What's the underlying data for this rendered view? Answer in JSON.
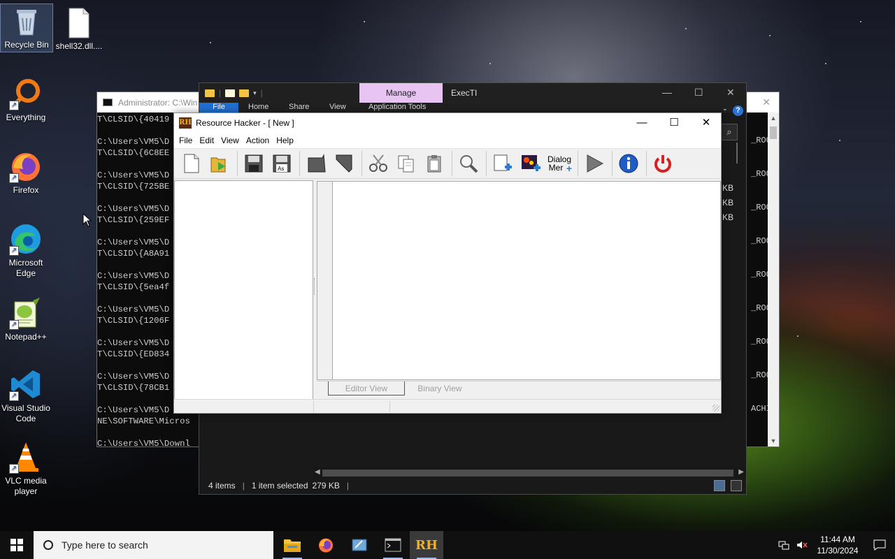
{
  "desktop": {
    "icons": [
      {
        "label": "Recycle Bin"
      },
      {
        "label": "shell32.dll...."
      },
      {
        "label": "Everything"
      },
      {
        "label": "Firefox"
      },
      {
        "label": "Microsoft Edge"
      },
      {
        "label": "Notepad++"
      },
      {
        "label": "Visual Studio Code"
      },
      {
        "label": "VLC media player"
      }
    ]
  },
  "console": {
    "title": "Administrator: C:\\Win",
    "lines": [
      "T\\CLSID\\{40419",
      "",
      "C:\\Users\\VM5\\D",
      "T\\CLSID\\{6C8EE",
      "",
      "C:\\Users\\VM5\\D",
      "T\\CLSID\\{725BE",
      "",
      "C:\\Users\\VM5\\D",
      "T\\CLSID\\{259EF",
      "",
      "C:\\Users\\VM5\\D",
      "T\\CLSID\\{A8A91",
      "",
      "C:\\Users\\VM5\\D",
      "T\\CLSID\\{5ea4f",
      "",
      "C:\\Users\\VM5\\D",
      "T\\CLSID\\{1206F",
      "",
      "C:\\Users\\VM5\\D",
      "T\\CLSID\\{ED834",
      "",
      "C:\\Users\\VM5\\D",
      "T\\CLSID\\{78CB1",
      "",
      "C:\\Users\\VM5\\D",
      "NE\\SOFTWARE\\Micros",
      "",
      "C:\\Users\\VM5\\Downl"
    ],
    "right_fragments": [
      "_ROO",
      "_ROO",
      "_ROO",
      "_ROO",
      "_ROO",
      "_ROO",
      "_ROO",
      "_ROO",
      "ACHI"
    ]
  },
  "explorer": {
    "manage_tab": "Manage",
    "title": "ExecTI",
    "ribbon_tabs": [
      "File",
      "Home",
      "Share",
      "View",
      "Application Tools"
    ],
    "sizes": [
      "KB",
      "KB",
      "KB"
    ],
    "status": {
      "items": "4 items",
      "selected": "1 item selected",
      "size": "279 KB"
    }
  },
  "rh": {
    "title": "Resource Hacker - [ New ]",
    "menu": [
      "File",
      "Edit",
      "View",
      "Action",
      "Help"
    ],
    "toolbar": {
      "dialog_menu_line1": "Dialog",
      "dialog_menu_line2": "Mer"
    },
    "tabs": {
      "editor": "Editor View",
      "binary": "Binary View"
    }
  },
  "taskbar": {
    "search_placeholder": "Type here to search",
    "time": "11:44 AM",
    "date": "11/30/2024"
  },
  "colors": {
    "manage_tab": "#e7c4f2",
    "file_tab": "#1f6fd1",
    "taskbar": "#101010"
  }
}
